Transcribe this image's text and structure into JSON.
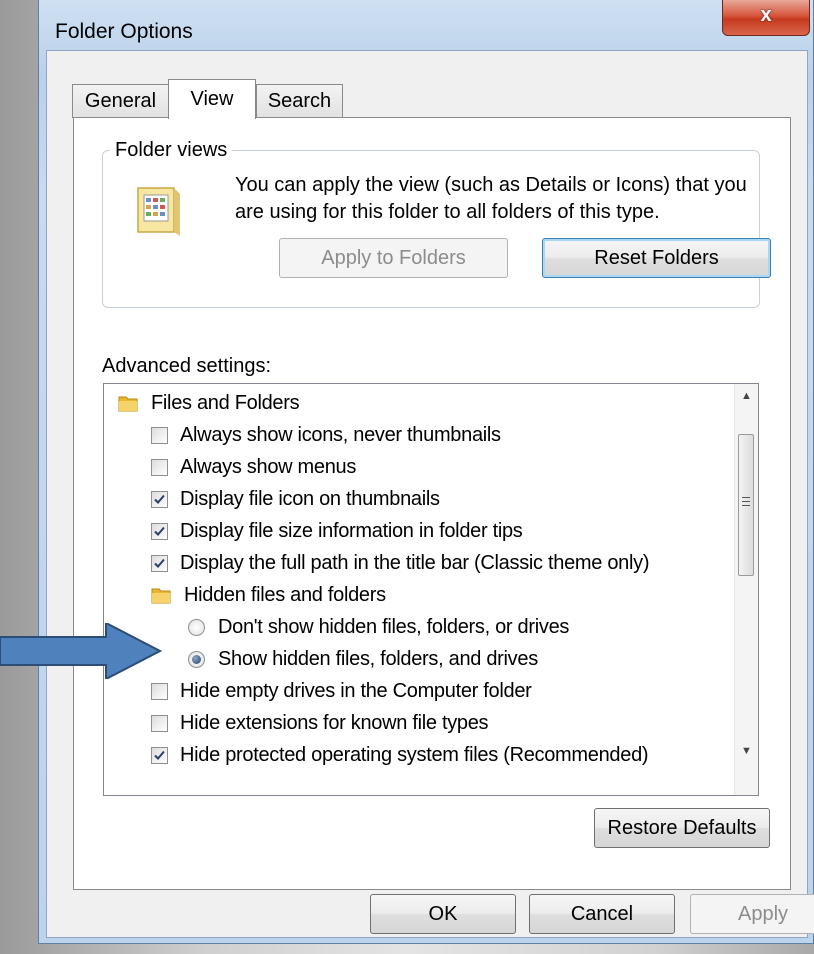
{
  "window": {
    "title": "Folder Options",
    "close_label": "x"
  },
  "tabs": [
    {
      "label": "General",
      "active": false
    },
    {
      "label": "View",
      "active": true
    },
    {
      "label": "Search",
      "active": false
    }
  ],
  "folder_views": {
    "group_label": "Folder views",
    "description": "You can apply the view (such as Details or Icons) that you are using for this folder to all folders of this type.",
    "apply_button": "Apply to Folders",
    "reset_button": "Reset Folders"
  },
  "advanced": {
    "label": "Advanced settings:",
    "items": [
      {
        "type": "folder",
        "label": "Files and Folders"
      },
      {
        "type": "checkbox",
        "label": "Always show icons, never thumbnails",
        "checked": false
      },
      {
        "type": "checkbox",
        "label": "Always show menus",
        "checked": false
      },
      {
        "type": "checkbox",
        "label": "Display file icon on thumbnails",
        "checked": true
      },
      {
        "type": "checkbox",
        "label": "Display file size information in folder tips",
        "checked": true
      },
      {
        "type": "checkbox",
        "label": "Display the full path in the title bar (Classic theme only)",
        "checked": true
      },
      {
        "type": "folder",
        "label": "Hidden files and folders"
      },
      {
        "type": "radio",
        "label": "Don't show hidden files, folders, or drives",
        "checked": false
      },
      {
        "type": "radio",
        "label": "Show hidden files, folders, and drives",
        "checked": true
      },
      {
        "type": "checkbox",
        "label": "Hide empty drives in the Computer folder",
        "checked": false
      },
      {
        "type": "checkbox",
        "label": "Hide extensions for known file types",
        "checked": false
      },
      {
        "type": "checkbox",
        "label": "Hide protected operating system files (Recommended)",
        "checked": true
      }
    ]
  },
  "restore_defaults": "Restore Defaults",
  "footer": {
    "ok": "OK",
    "cancel": "Cancel",
    "apply": "Apply"
  },
  "colors": {
    "arrow": "#4f81bd",
    "arrow_border": "#2c4d75",
    "checkmark": "#2a3f6a"
  }
}
